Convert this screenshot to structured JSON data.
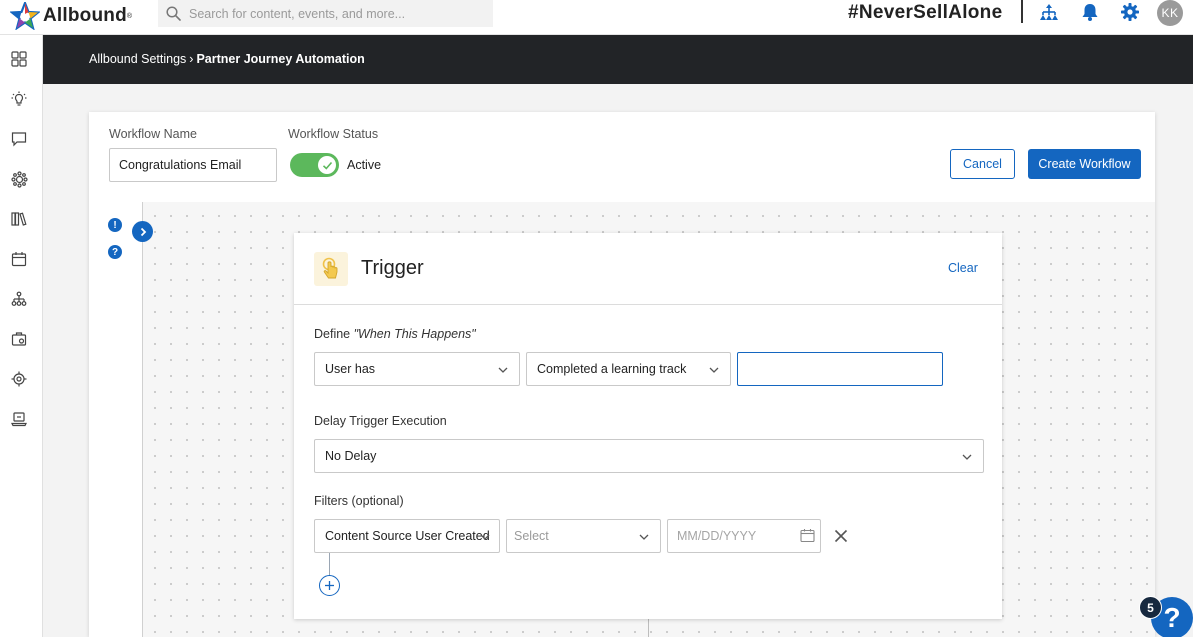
{
  "topbar": {
    "brand": "Allbound",
    "search_placeholder": "Search for content, events, and more...",
    "hashtag": "#NeverSellAlone",
    "avatar_initials": "KK",
    "icons": [
      "org-chart-icon",
      "bell-icon",
      "gear-icon"
    ]
  },
  "sidebar": {
    "icons": [
      "dashboard-icon",
      "lightbulb-icon",
      "chat-icon",
      "partners-icon",
      "library-icon",
      "calendar-icon",
      "hierarchy-icon",
      "briefcase-icon",
      "target-icon",
      "laptop-icon"
    ]
  },
  "breadcrumb": {
    "parent": "Allbound Settings",
    "separator": "›",
    "current": "Partner Journey Automation"
  },
  "workflow": {
    "name_label": "Workflow Name",
    "name_value": "Congratulations Email",
    "status_label": "Workflow Status",
    "status_value": "Active",
    "status_on": true,
    "cancel_label": "Cancel",
    "create_label": "Create Workflow"
  },
  "side_badges": {
    "alert": "!",
    "help": "?"
  },
  "trigger": {
    "title": "Trigger",
    "clear_label": "Clear",
    "define_prefix": "Define ",
    "define_quote": "\"When This Happens\"",
    "condition_subject": "User has",
    "condition_action": "Completed a learning track",
    "condition_value": "",
    "delay_label": "Delay Trigger Execution",
    "delay_value": "No Delay",
    "filters_label": "Filters (optional)",
    "filter_field": "Content Source User Created",
    "filter_operator_placeholder": "Select",
    "filter_date_placeholder": "MM/DD/YYYY"
  },
  "help_widget": {
    "badge_count": "5",
    "symbol": "?"
  },
  "colors": {
    "primary": "#1466c0",
    "header_band": "#222427",
    "toggle_on": "#5cb85c"
  }
}
